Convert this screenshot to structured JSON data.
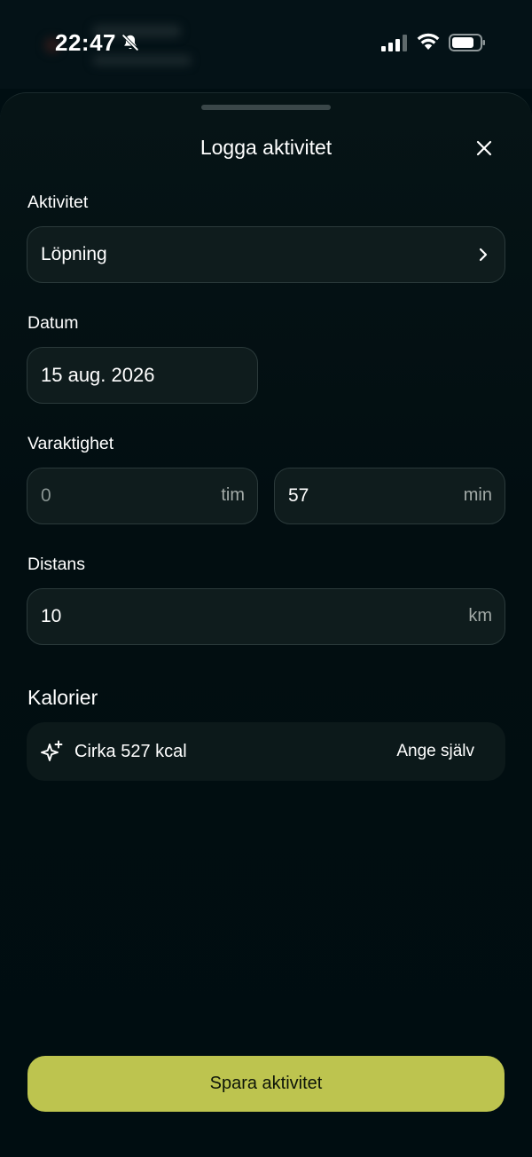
{
  "status_bar": {
    "time": "22:47",
    "icons": [
      "bell-slash-icon",
      "cellular-signal-icon",
      "wifi-icon",
      "battery-icon"
    ]
  },
  "sheet": {
    "title": "Logga aktivitet",
    "close_icon": "close-icon"
  },
  "form": {
    "activity": {
      "label": "Aktivitet",
      "value": "Löpning",
      "icon": "chevron-right-icon"
    },
    "date": {
      "label": "Datum",
      "value": "15 aug. 2026"
    },
    "duration": {
      "label": "Varaktighet",
      "hours": {
        "value": "0",
        "unit": "tim"
      },
      "minutes": {
        "value": "57",
        "unit": "min"
      }
    },
    "distance": {
      "label": "Distans",
      "value": "10",
      "unit": "km"
    }
  },
  "calories": {
    "title": "Kalorier",
    "icon": "sparkle-icon",
    "estimate": "Cirka 527 kcal",
    "action": "Ange själv"
  },
  "primary_action": {
    "label": "Spara aktivitet"
  },
  "colors": {
    "background": "#000e12",
    "field_bg": "#0f1c1d",
    "field_border": "#2b3a3b",
    "accent": "#bdc44f",
    "muted_text": "#a3aba8"
  }
}
